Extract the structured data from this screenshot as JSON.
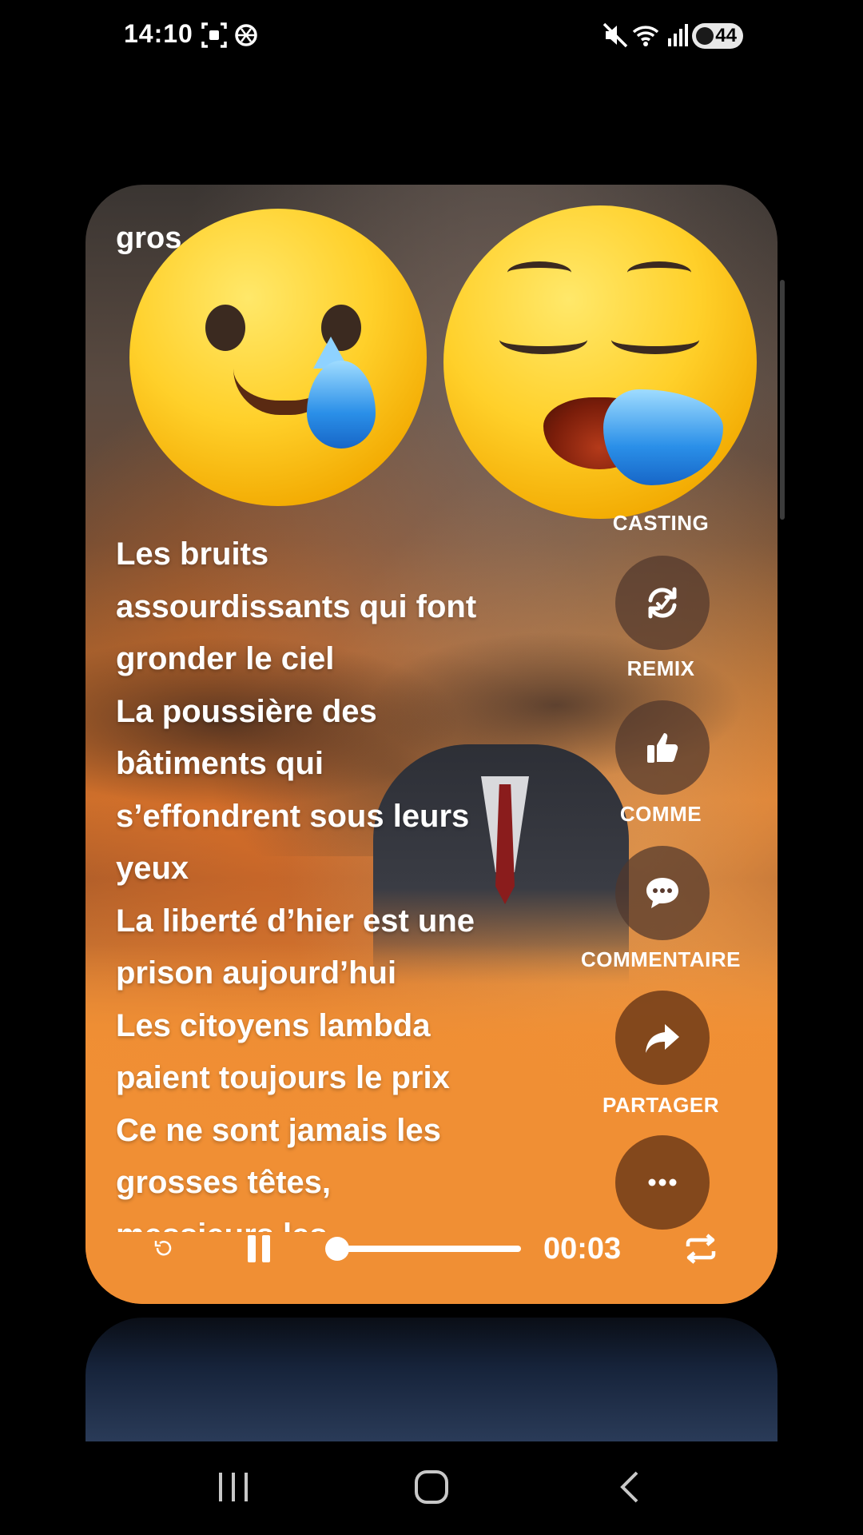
{
  "status_bar": {
    "time": "14:10",
    "battery": "44",
    "icons": [
      "screen-record-icon",
      "openai-icon",
      "mute-icon",
      "wifi-icon",
      "signal-icon",
      "battery-icon"
    ]
  },
  "card": {
    "title_fragment": "gros",
    "emojis": [
      "crying-face-emoji",
      "sad-relieved-face-emoji"
    ],
    "lyrics": [
      " Les bruits",
      "assourdissants qui font",
      "gronder le ciel",
      "La poussière des",
      "bâtiments qui",
      "s’effondrent sous leurs",
      "yeux",
      "La liberté d’hier est une",
      "prison aujourd’hui",
      "Les citoyens lambda",
      "paient toujours le prix",
      "Ce ne sont jamais les",
      "grosses têtes,",
      "messieurs les"
    ]
  },
  "actions": {
    "casting": "CASTING",
    "remix": "REMIX",
    "like": "COMME",
    "comment": "COMMENTAIRE",
    "share": "PARTAGER"
  },
  "player": {
    "elapsed": "00:03",
    "progress": 0.0,
    "state": "playing"
  },
  "colors": {
    "accent_orange": "#f08f34",
    "background": "#000000"
  }
}
